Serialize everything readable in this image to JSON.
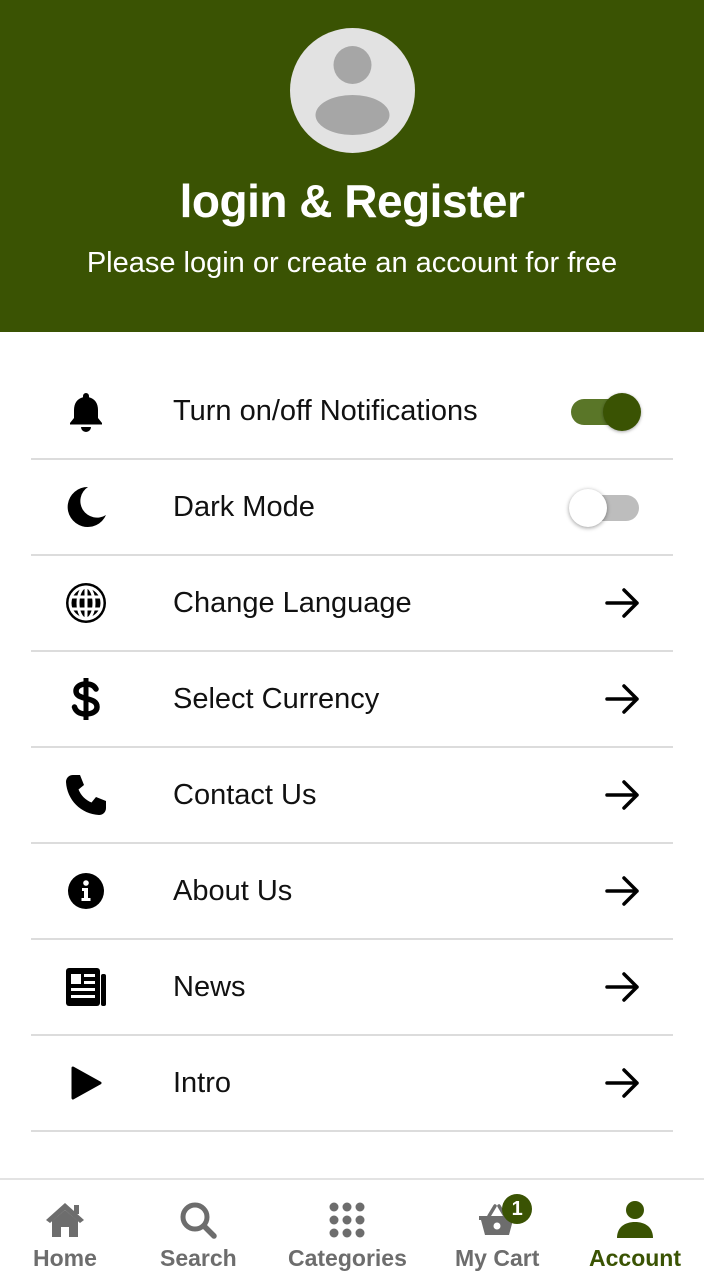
{
  "header": {
    "title": "login & Register",
    "subtitle": "Please login or create an account for free",
    "background_color": "#3a5303"
  },
  "menu": {
    "items": [
      {
        "label": "Turn on/off Notifications",
        "icon": "bell-icon",
        "trailing": "toggle",
        "toggle_on": true
      },
      {
        "label": "Dark Mode",
        "icon": "moon-icon",
        "trailing": "toggle",
        "toggle_on": false
      },
      {
        "label": "Change Language",
        "icon": "globe-icon",
        "trailing": "arrow-right-icon"
      },
      {
        "label": "Select Currency",
        "icon": "dollar-icon",
        "trailing": "arrow-right-icon"
      },
      {
        "label": "Contact Us",
        "icon": "phone-icon",
        "trailing": "arrow-right-icon"
      },
      {
        "label": "About Us",
        "icon": "info-icon",
        "trailing": "arrow-right-icon"
      },
      {
        "label": "News",
        "icon": "newspaper-icon",
        "trailing": "arrow-right-icon"
      },
      {
        "label": "Intro",
        "icon": "play-icon",
        "trailing": "arrow-right-icon"
      }
    ]
  },
  "bottom_nav": {
    "items": [
      {
        "label": "Home",
        "icon": "home-icon",
        "active": false
      },
      {
        "label": "Search",
        "icon": "search-icon",
        "active": false
      },
      {
        "label": "Categories",
        "icon": "grid-icon",
        "active": false
      },
      {
        "label": "My Cart",
        "icon": "basket-icon",
        "active": false,
        "badge": "1"
      },
      {
        "label": "Account",
        "icon": "person-icon",
        "active": true
      }
    ],
    "active_color": "#3a5303",
    "inactive_color": "#6d6d6d"
  }
}
